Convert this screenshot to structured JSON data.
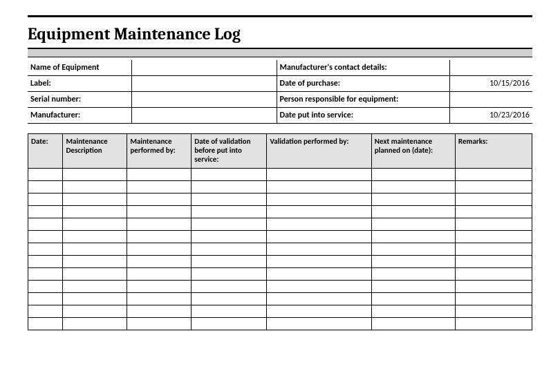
{
  "title": "Equipment Maintenance Log",
  "info": {
    "name_label": "Name of Equipment",
    "name_value": "",
    "mfr_contact_label": "Manufacturer's contact details:",
    "mfr_contact_value": "",
    "label_label": "Label:",
    "label_value": "",
    "purchase_label": "Date of purchase:",
    "purchase_value": "10/15/2016",
    "serial_label": "Serial number:",
    "serial_value": "",
    "person_label": "Person responsible for equipment:",
    "person_value": "",
    "mfr_label": "Manufacturer:",
    "mfr_value": "",
    "service_label": "Date put into service:",
    "service_value": "10/23/2016"
  },
  "columns": {
    "date": "Date:",
    "desc": "Maintenance Description",
    "perf": "Maintenance performed by:",
    "valid": "Date of validation before put into service:",
    "validby": "Validation performed by:",
    "next": "Next maintenance planned on (date):",
    "remarks": "Remarks:"
  },
  "rows": [
    {
      "date": "",
      "desc": "",
      "perf": "",
      "valid": "",
      "validby": "",
      "next": "",
      "remarks": ""
    },
    {
      "date": "",
      "desc": "",
      "perf": "",
      "valid": "",
      "validby": "",
      "next": "",
      "remarks": ""
    },
    {
      "date": "",
      "desc": "",
      "perf": "",
      "valid": "",
      "validby": "",
      "next": "",
      "remarks": ""
    },
    {
      "date": "",
      "desc": "",
      "perf": "",
      "valid": "",
      "validby": "",
      "next": "",
      "remarks": ""
    },
    {
      "date": "",
      "desc": "",
      "perf": "",
      "valid": "",
      "validby": "",
      "next": "",
      "remarks": ""
    },
    {
      "date": "",
      "desc": "",
      "perf": "",
      "valid": "",
      "validby": "",
      "next": "",
      "remarks": ""
    },
    {
      "date": "",
      "desc": "",
      "perf": "",
      "valid": "",
      "validby": "",
      "next": "",
      "remarks": ""
    },
    {
      "date": "",
      "desc": "",
      "perf": "",
      "valid": "",
      "validby": "",
      "next": "",
      "remarks": ""
    },
    {
      "date": "",
      "desc": "",
      "perf": "",
      "valid": "",
      "validby": "",
      "next": "",
      "remarks": ""
    },
    {
      "date": "",
      "desc": "",
      "perf": "",
      "valid": "",
      "validby": "",
      "next": "",
      "remarks": ""
    },
    {
      "date": "",
      "desc": "",
      "perf": "",
      "valid": "",
      "validby": "",
      "next": "",
      "remarks": ""
    },
    {
      "date": "",
      "desc": "",
      "perf": "",
      "valid": "",
      "validby": "",
      "next": "",
      "remarks": ""
    },
    {
      "date": "",
      "desc": "",
      "perf": "",
      "valid": "",
      "validby": "",
      "next": "",
      "remarks": ""
    }
  ]
}
